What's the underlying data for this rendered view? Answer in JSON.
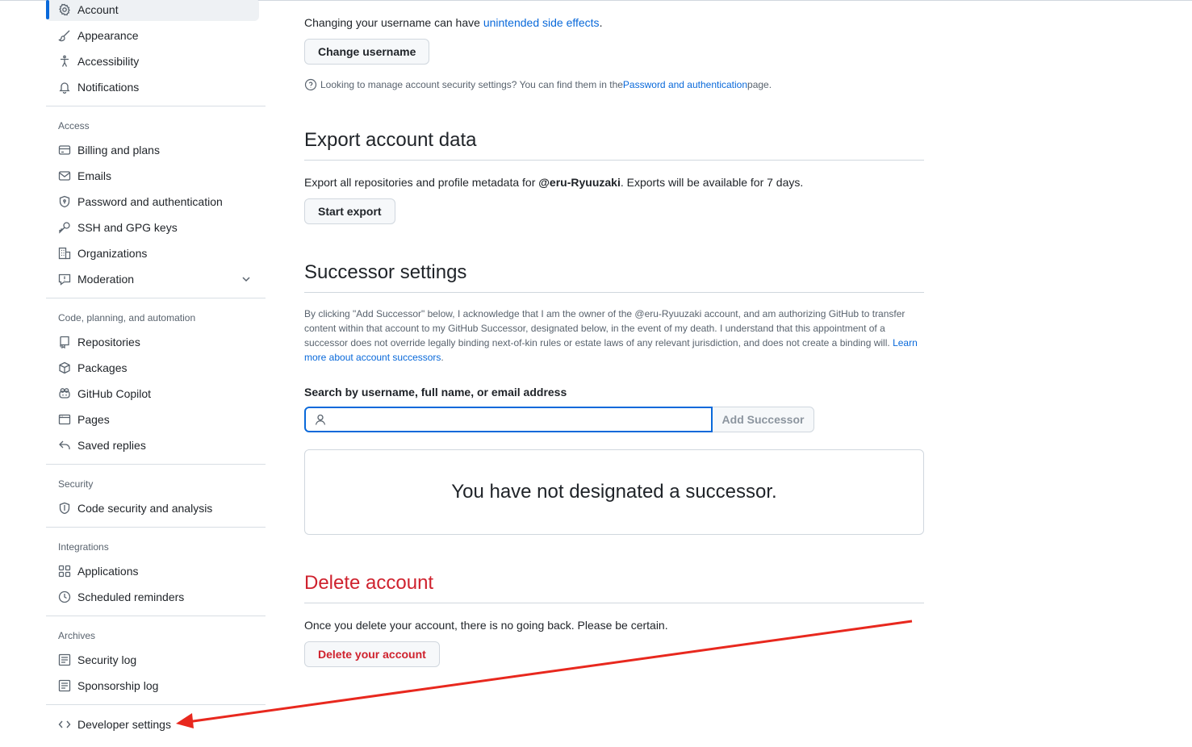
{
  "sidebar": {
    "top_items": [
      {
        "label": "Account",
        "icon": "gear-icon"
      },
      {
        "label": "Appearance",
        "icon": "paintbrush-icon"
      },
      {
        "label": "Accessibility",
        "icon": "accessibility-icon"
      },
      {
        "label": "Notifications",
        "icon": "bell-icon"
      }
    ],
    "groups": [
      {
        "title": "Access",
        "items": [
          {
            "label": "Billing and plans",
            "icon": "credit-card-icon"
          },
          {
            "label": "Emails",
            "icon": "mail-icon"
          },
          {
            "label": "Password and authentication",
            "icon": "shield-lock-icon"
          },
          {
            "label": "SSH and GPG keys",
            "icon": "key-icon"
          },
          {
            "label": "Organizations",
            "icon": "organization-icon"
          },
          {
            "label": "Moderation",
            "icon": "report-icon"
          }
        ]
      },
      {
        "title": "Code, planning, and automation",
        "items": [
          {
            "label": "Repositories",
            "icon": "repo-icon"
          },
          {
            "label": "Packages",
            "icon": "package-icon"
          },
          {
            "label": "GitHub Copilot",
            "icon": "copilot-icon"
          },
          {
            "label": "Pages",
            "icon": "browser-icon"
          },
          {
            "label": "Saved replies",
            "icon": "reply-icon"
          }
        ]
      },
      {
        "title": "Security",
        "items": [
          {
            "label": "Code security and analysis",
            "icon": "shield-check-icon"
          }
        ]
      },
      {
        "title": "Integrations",
        "items": [
          {
            "label": "Applications",
            "icon": "apps-icon"
          },
          {
            "label": "Scheduled reminders",
            "icon": "clock-icon"
          }
        ]
      },
      {
        "title": "Archives",
        "items": [
          {
            "label": "Security log",
            "icon": "log-icon"
          },
          {
            "label": "Sponsorship log",
            "icon": "log-icon"
          }
        ]
      }
    ],
    "developer": {
      "label": "Developer settings",
      "icon": "code-icon"
    }
  },
  "main": {
    "username": {
      "warning_prefix": "Changing your username can have ",
      "warning_link": "unintended side effects",
      "warning_suffix": ".",
      "button": "Change username",
      "note_prefix": "Looking to manage account security settings? You can find them in the ",
      "note_link": "Password and authentication",
      "note_suffix": " page."
    },
    "export": {
      "heading": "Export account data",
      "text_prefix": "Export all repositories and profile metadata for ",
      "text_user": "@eru-Ryuuzaki",
      "text_suffix": ". Exports will be available for 7 days.",
      "button": "Start export"
    },
    "successor": {
      "heading": "Successor settings",
      "paragraph": "By clicking \"Add Successor\" below, I acknowledge that I am the owner of the @eru-Ryuuzaki account, and am authorizing GitHub to transfer content within that account to my GitHub Successor, designated below, in the event of my death. I understand that this appointment of a successor does not override legally binding next-of-kin rules or estate laws of any relevant jurisdiction, and does not create a binding will. ",
      "paragraph_link": "Learn more about account successors",
      "paragraph_suffix": ".",
      "search_label": "Search by username, full name, or email address",
      "search_value": "",
      "add_button": "Add Successor",
      "empty_message": "You have not designated a successor."
    },
    "delete": {
      "heading": "Delete account",
      "text": "Once you delete your account, there is no going back. Please be certain.",
      "button": "Delete your account"
    }
  },
  "colors": {
    "accent": "#0969da",
    "danger": "#cf222e",
    "annotation_arrow": "#e8281e"
  }
}
